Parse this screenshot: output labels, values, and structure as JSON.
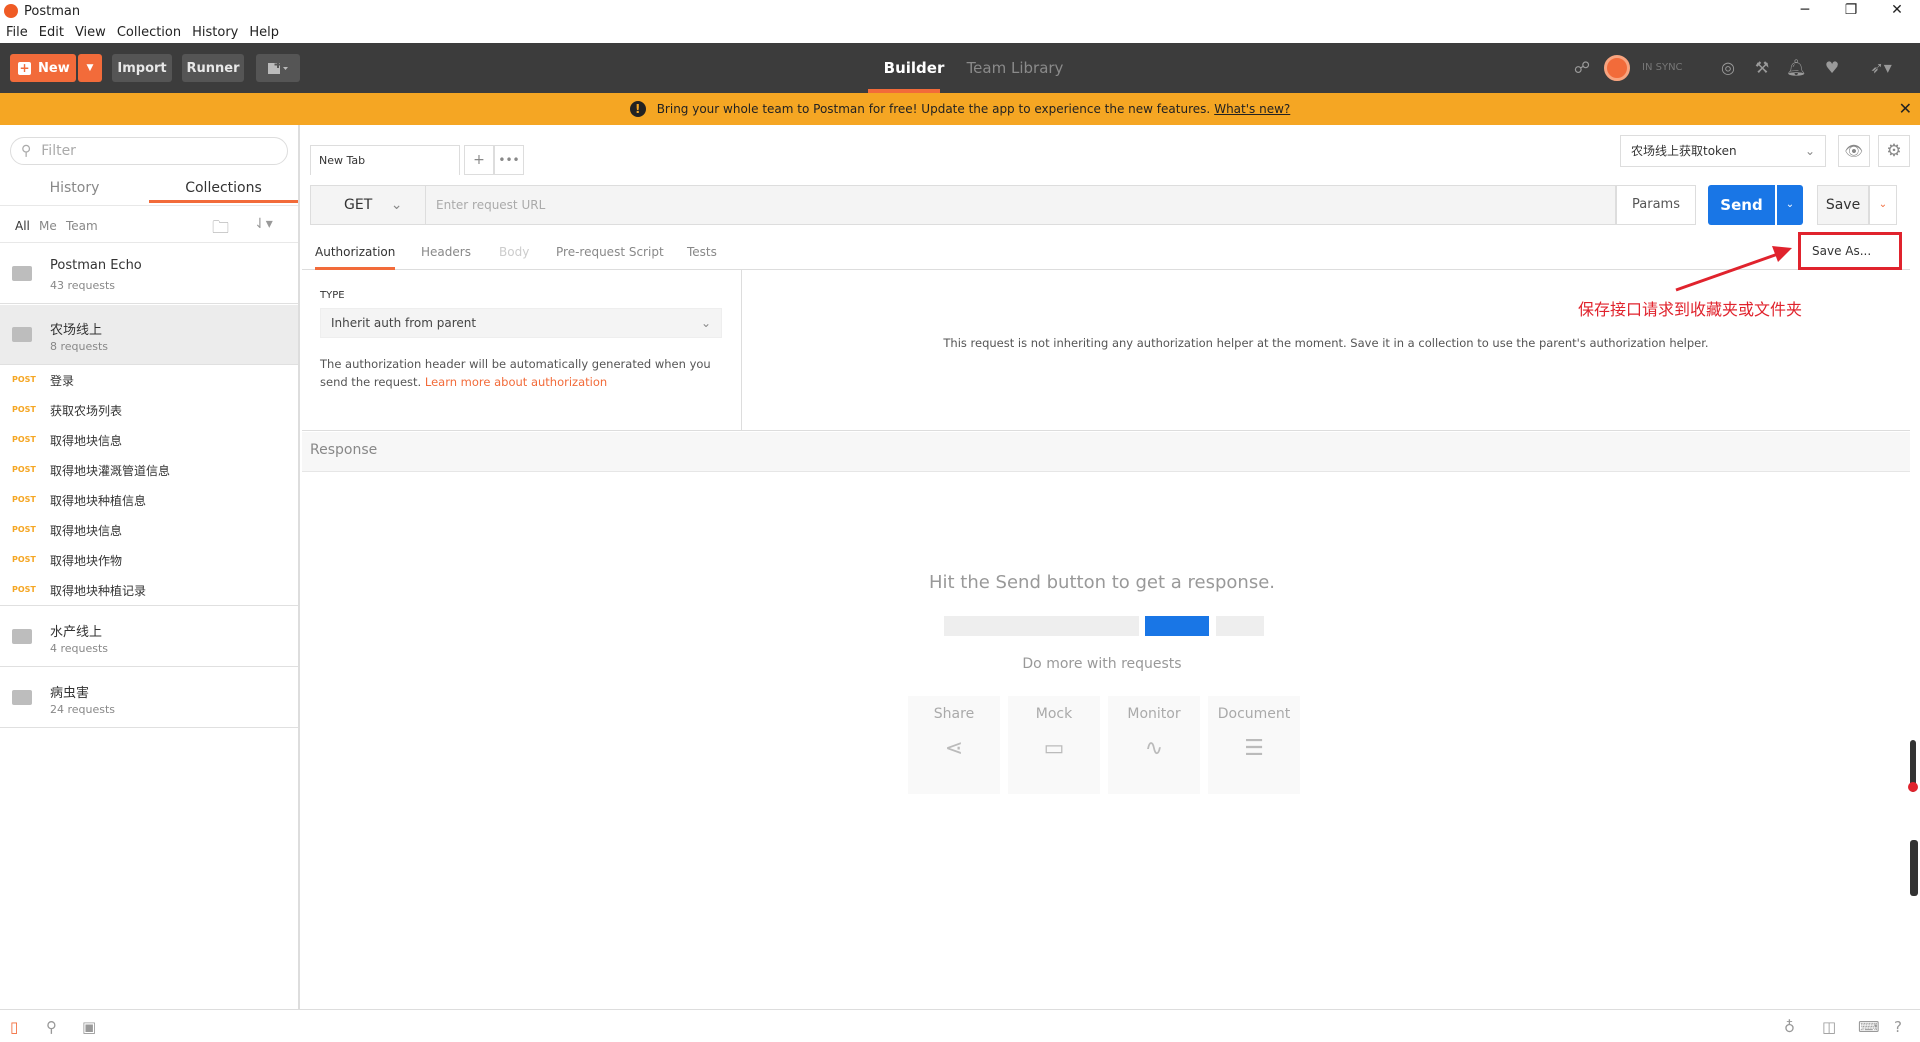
{
  "window": {
    "title": "Postman",
    "controls": [
      "─",
      "❐",
      "✕"
    ]
  },
  "menu": [
    "File",
    "Edit",
    "View",
    "Collection",
    "History",
    "Help"
  ],
  "toolbar": {
    "new_label": "New",
    "import_label": "Import",
    "runner_label": "Runner",
    "builder_tab": "Builder",
    "team_library_tab": "Team Library",
    "sync_status": "IN SYNC"
  },
  "banner": {
    "message": "Bring your whole team to Postman for free! Update the app to experience the new features.",
    "link": "What's new?"
  },
  "sidebar": {
    "filter_placeholder": "Filter",
    "tabs": [
      "History",
      "Collections"
    ],
    "active_tab": "Collections",
    "filters": [
      "All",
      "Me",
      "Team"
    ],
    "collections": [
      {
        "name": "Postman Echo",
        "count": "43 requests"
      },
      {
        "name": "农场线上",
        "count": "8 requests"
      }
    ],
    "requests": [
      {
        "method": "POST",
        "name": "登录"
      },
      {
        "method": "POST",
        "name": "获取农场列表"
      },
      {
        "method": "POST",
        "name": "取得地块信息"
      },
      {
        "method": "POST",
        "name": "取得地块灌溉管道信息"
      },
      {
        "method": "POST",
        "name": "取得地块种植信息"
      },
      {
        "method": "POST",
        "name": "取得地块信息"
      },
      {
        "method": "POST",
        "name": "取得地块作物"
      },
      {
        "method": "POST",
        "name": "取得地块种植记录"
      }
    ],
    "collections_after": [
      {
        "name": "水产线上",
        "count": "4 requests"
      },
      {
        "name": "病虫害",
        "count": "24 requests"
      }
    ]
  },
  "tabs": {
    "current": "New Tab",
    "add": "+",
    "more": "•••"
  },
  "environment": {
    "selected": "农场线上获取token"
  },
  "request": {
    "method": "GET",
    "url_placeholder": "Enter request URL",
    "params_label": "Params",
    "send_label": "Send",
    "save_label": "Save",
    "save_as_label": "Save As...",
    "tabs": [
      "Authorization",
      "Headers",
      "Body",
      "Pre-request Script",
      "Tests"
    ],
    "active_tab": "Authorization"
  },
  "auth": {
    "type_label": "TYPE",
    "type_value": "Inherit auth from parent",
    "description": "The authorization header will be automatically generated when you send the request.",
    "learn_more": "Learn more about authorization",
    "message": "This request is not inheriting any authorization helper at the moment. Save it in a collection to use the parent's authorization helper."
  },
  "annotation": {
    "text": "保存接口请求到收藏夹或文件夹",
    "color": "#e0232d"
  },
  "response": {
    "label": "Response",
    "empty_message": "Hit the Send button to get a response.",
    "do_more": "Do more with requests",
    "cards": [
      "Share",
      "Mock",
      "Monitor",
      "Document"
    ]
  },
  "colors": {
    "accent": "#f26b3a",
    "send": "#1976e6",
    "banner": "#f5a623",
    "toolbar": "#3c3c3c"
  }
}
